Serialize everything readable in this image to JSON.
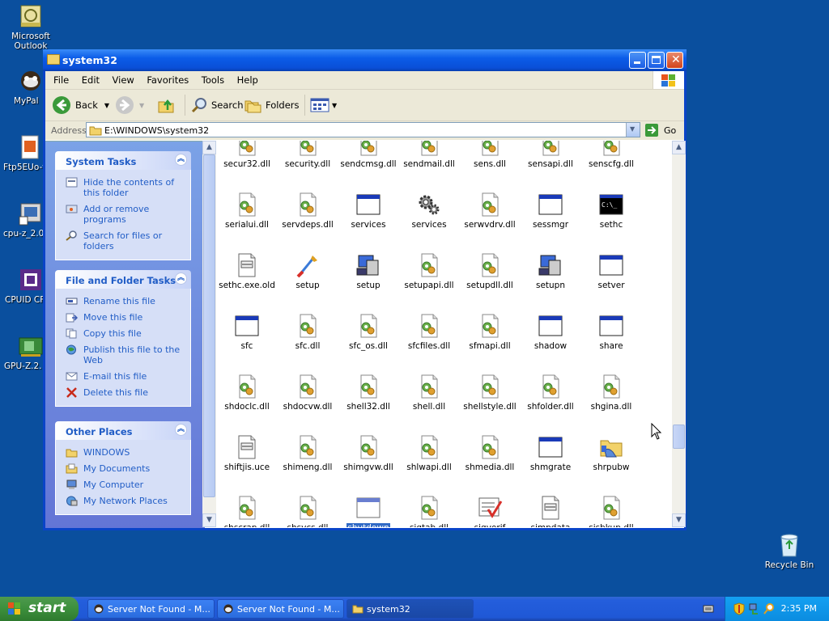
{
  "desktop": {
    "icons": [
      "Microsoft Outlook",
      "MyPal",
      "Ftp5EUo-t",
      "cpu-z_2.0",
      "CPUID CF",
      "GPU-Z.2."
    ],
    "recycle_bin": "Recycle Bin"
  },
  "window": {
    "title": "system32",
    "menu": [
      "File",
      "Edit",
      "View",
      "Favorites",
      "Tools",
      "Help"
    ],
    "toolbar": {
      "back": "Back",
      "search": "Search",
      "folders": "Folders"
    },
    "address": {
      "label": "Address",
      "value": "E:\\WINDOWS\\system32",
      "go": "Go"
    }
  },
  "left_pane": {
    "system_tasks": {
      "title": "System Tasks",
      "items": [
        "Hide the contents of this folder",
        "Add or remove programs",
        "Search for files or folders"
      ]
    },
    "file_folder_tasks": {
      "title": "File and Folder Tasks",
      "items": [
        "Rename this file",
        "Move this file",
        "Copy this file",
        "Publish this file to the Web",
        "E-mail this file",
        "Delete this file"
      ]
    },
    "other_places": {
      "title": "Other Places",
      "items": [
        "WINDOWS",
        "My Documents",
        "My Computer",
        "My Network Places"
      ]
    }
  },
  "files": [
    [
      "secur32.dll",
      "security.dll",
      "sendcmsg.dll",
      "sendmail.dll",
      "sens.dll",
      "sensapi.dll",
      "senscfg.dll"
    ],
    [
      "serialui.dll",
      "servdeps.dll",
      "services",
      "services",
      "serwvdrv.dll",
      "sessmgr",
      "sethc"
    ],
    [
      "sethc.exe.old",
      "setup",
      "setup",
      "setupapi.dll",
      "setupdll.dll",
      "setupn",
      "setver"
    ],
    [
      "sfc",
      "sfc.dll",
      "sfc_os.dll",
      "sfcfiles.dll",
      "sfmapi.dll",
      "shadow",
      "share"
    ],
    [
      "shdoclc.dll",
      "shdocvw.dll",
      "shell32.dll",
      "shell.dll",
      "shellstyle.dll",
      "shfolder.dll",
      "shgina.dll"
    ],
    [
      "shiftjis.uce",
      "shimeng.dll",
      "shimgvw.dll",
      "shlwapi.dll",
      "shmedia.dll",
      "shmgrate",
      "shrpubw"
    ],
    [
      "shscrap.dll",
      "shsvcs.dll",
      "shutdown",
      "sigtab.dll",
      "sigverif",
      "simpdata",
      "sisbkup.dll"
    ]
  ],
  "file_icons": [
    [
      "dll",
      "dll",
      "dll",
      "dll",
      "dll",
      "dll",
      "dll"
    ],
    [
      "dll",
      "dll",
      "window",
      "gear",
      "dll",
      "window",
      "console"
    ],
    [
      "text",
      "setup-brush",
      "setup-pc",
      "dll",
      "dll",
      "setup-pc",
      "window"
    ],
    [
      "window",
      "dll",
      "dll",
      "dll",
      "dll",
      "window",
      "window"
    ],
    [
      "dll",
      "dll",
      "dll",
      "dll",
      "dll",
      "dll",
      "dll"
    ],
    [
      "text",
      "dll",
      "dll",
      "dll",
      "dll",
      "window",
      "share-folder"
    ],
    [
      "dll",
      "dll",
      "window",
      "dll",
      "checklist",
      "text",
      "dll"
    ]
  ],
  "selected_file": "shutdown",
  "taskbar": {
    "start": "start",
    "tasks": [
      "Server Not Found - M...",
      "Server Not Found - M...",
      "system32"
    ],
    "clock": "2:35 PM"
  }
}
